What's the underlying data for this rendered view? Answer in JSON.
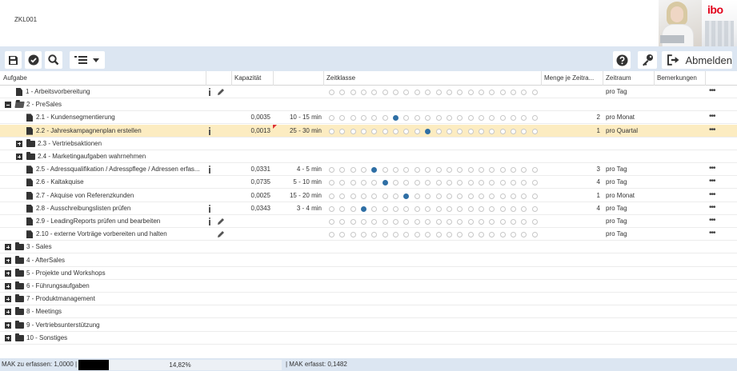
{
  "header": {
    "app_id": "ZKL001",
    "brand": "ibo"
  },
  "toolbar": {
    "icons": [
      "save-icon",
      "check-icon",
      "search-icon",
      "list-view-icon",
      "chevron-down-icon",
      "help-icon",
      "key-icon",
      "logout-icon"
    ],
    "logout_label": "Abmelden"
  },
  "columns": {
    "task": "Aufgabe",
    "capacity": "Kapazität",
    "time_class": "Zeitklasse",
    "amount": "Menge je Zeitra...",
    "period": "Zeitraum",
    "remarks": "Bemerkungen"
  },
  "rows": [
    {
      "level": 1,
      "kind": "doc",
      "label": "1 - Arbeitsvorbereitung",
      "info": true,
      "edit": true,
      "capacity": "",
      "time": "",
      "dot": null,
      "amount": "",
      "period": "pro Tag",
      "more": true
    },
    {
      "level": 0,
      "kind": "folder-open",
      "label": "2 - PreSales",
      "info": false,
      "edit": false,
      "capacity": "",
      "time": "",
      "dot": null,
      "amount": "",
      "period": "",
      "more": false,
      "noDots": true
    },
    {
      "level": 2,
      "kind": "doc",
      "label": "2.1 - Kundensegmentierung",
      "info": false,
      "edit": false,
      "capacity": "0,0035",
      "time": "10 - 15 min",
      "dot": 6,
      "amount": "2",
      "period": "pro Monat",
      "more": true
    },
    {
      "level": 2,
      "kind": "doc",
      "label": "2.2 - Jahreskampagnenplan erstellen",
      "info": true,
      "edit": false,
      "capacity": "0,0013",
      "time": "25 - 30 min",
      "dot": 9,
      "amount": "1",
      "period": "pro Quartal",
      "more": true,
      "selected": true,
      "flag": true
    },
    {
      "level": 1,
      "kind": "folder",
      "label": "2.3 - Vertriebsaktionen",
      "info": false,
      "edit": false,
      "capacity": "",
      "time": "",
      "dot": null,
      "amount": "",
      "period": "",
      "more": false,
      "noDots": true
    },
    {
      "level": 1,
      "kind": "folder",
      "label": "2.4 - Marketingaufgaben wahrnehmen",
      "info": false,
      "edit": false,
      "capacity": "",
      "time": "",
      "dot": null,
      "amount": "",
      "period": "",
      "more": false,
      "noDots": true
    },
    {
      "level": 2,
      "kind": "doc",
      "label": "2.5 - Adressqualifikation / Adresspflege / Adressen erfas...",
      "info": true,
      "edit": false,
      "capacity": "0,0331",
      "time": "4 - 5 min",
      "dot": 4,
      "amount": "3",
      "period": "pro Tag",
      "more": true
    },
    {
      "level": 2,
      "kind": "doc",
      "label": "2.6 - Kaltakquise",
      "info": false,
      "edit": false,
      "capacity": "0,0735",
      "time": "5 - 10 min",
      "dot": 5,
      "amount": "4",
      "period": "pro Tag",
      "more": true
    },
    {
      "level": 2,
      "kind": "doc",
      "label": "2.7 - Akquise von Referenzkunden",
      "info": false,
      "edit": false,
      "capacity": "0,0025",
      "time": "15 - 20 min",
      "dot": 7,
      "amount": "1",
      "period": "pro Monat",
      "more": true
    },
    {
      "level": 2,
      "kind": "doc",
      "label": "2.8 - Ausschreibungslisten prüfen",
      "info": true,
      "edit": false,
      "capacity": "0,0343",
      "time": "3 - 4 min",
      "dot": 3,
      "amount": "4",
      "period": "pro Tag",
      "more": true
    },
    {
      "level": 2,
      "kind": "doc",
      "label": "2.9 - LeadingReports prüfen und bearbeiten",
      "info": true,
      "edit": true,
      "capacity": "",
      "time": "",
      "dot": null,
      "amount": "",
      "period": "pro Tag",
      "more": true
    },
    {
      "level": 2,
      "kind": "doc",
      "label": "2.10 - externe Vorträge vorbereiten und halten",
      "info": false,
      "edit": true,
      "capacity": "",
      "time": "",
      "dot": null,
      "amount": "",
      "period": "pro Tag",
      "more": true
    },
    {
      "level": 0,
      "kind": "folder",
      "label": "3 - Sales",
      "noDots": true
    },
    {
      "level": 0,
      "kind": "folder",
      "label": "4 - AfterSales",
      "noDots": true
    },
    {
      "level": 0,
      "kind": "folder",
      "label": "5 - Projekte und Workshops",
      "noDots": true
    },
    {
      "level": 0,
      "kind": "folder",
      "label": "6 - Führungsaufgaben",
      "noDots": true
    },
    {
      "level": 0,
      "kind": "folder",
      "label": "7 - Produktmanagement",
      "noDots": true
    },
    {
      "level": 0,
      "kind": "folder",
      "label": "8 - Meetings",
      "noDots": true
    },
    {
      "level": 0,
      "kind": "folder",
      "label": "9 - Vertriebsunterstützung",
      "noDots": true
    },
    {
      "level": 0,
      "kind": "folder",
      "label": "10 - Sonstiges",
      "noDots": true
    }
  ],
  "status": {
    "mak_to_capture": "MAK zu erfassen: 1,0000 |",
    "progress_label": "14,82%",
    "progress_value": 0.1482,
    "mak_captured": "| MAK erfasst: 0,1482"
  },
  "colors": {
    "accent": "#2f6fa5",
    "toolbar_bg": "#dce6f2",
    "selected_row": "#fcecc1",
    "brand_red": "#e2001a"
  }
}
